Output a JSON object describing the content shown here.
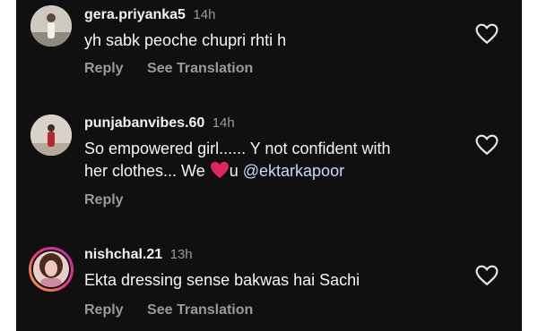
{
  "comments": [
    {
      "username": "gera.priyanka5",
      "time": "14h",
      "text": "yh sabk peoche chupri rhti h",
      "reply_label": "Reply",
      "translation_label": "See Translation"
    },
    {
      "username": "punjabanvibes.60",
      "time": "14h",
      "text_line1": "So empowered girl...... Y not confident with",
      "text_line2_before": "her clothes... We ",
      "text_line2_after": "u ",
      "mention": "@ektarkapoor",
      "reply_label": "Reply"
    },
    {
      "username": "nishchal.21",
      "time": "13h",
      "text": "Ekta dressing sense bakwas hai Sachi",
      "reply_label": "Reply",
      "translation_label": "See Translation"
    }
  ],
  "icons": {
    "like": "heart-outline-icon",
    "emoji": "red-heart-emoji"
  },
  "colors": {
    "background": "#101010",
    "text": "#f5f5f5",
    "muted": "#9a9a9a",
    "mention": "#c9d8ff",
    "emoji_heart": "#e0245e"
  }
}
